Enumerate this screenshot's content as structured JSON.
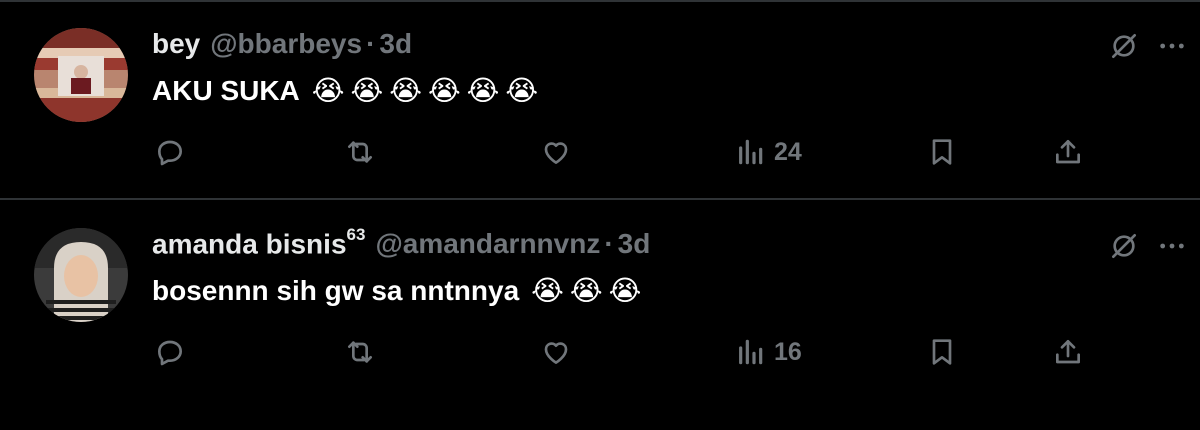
{
  "tweets": [
    {
      "name": "bey",
      "name_sup": "",
      "handle": "@bbarbeys",
      "separator": "·",
      "time": "3d",
      "text": "AKU SUKA",
      "emojis": [
        "😭",
        "😭",
        "😭",
        "😭",
        "😭",
        "😭"
      ],
      "views": "24",
      "icons": [
        "reply-icon",
        "retweet-icon",
        "like-icon",
        "views-icon",
        "bookmark-icon",
        "share-icon",
        "mute-icon",
        "more-icon"
      ]
    },
    {
      "name": "amanda bisnis",
      "name_sup": "63",
      "handle": "@amandarnnvnz",
      "separator": "·",
      "time": "3d",
      "text": "bosennn sih gw sa nntnnya",
      "emojis": [
        "😭",
        "😭",
        "😭"
      ],
      "views": "16",
      "icons": [
        "reply-icon",
        "retweet-icon",
        "like-icon",
        "views-icon",
        "bookmark-icon",
        "share-icon",
        "mute-icon",
        "more-icon"
      ]
    }
  ],
  "colors": {
    "background": "#000000",
    "text": "#e7e9ea",
    "secondary": "#71767b",
    "divider": "#2f3336"
  }
}
